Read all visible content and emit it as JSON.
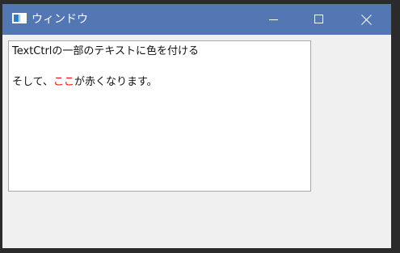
{
  "window": {
    "title": "ウィンドウ",
    "icon": "app-window-icon",
    "controls": {
      "minimize_icon": "minimize-icon",
      "maximize_icon": "maximize-icon",
      "close_icon": "close-icon"
    }
  },
  "textctrl": {
    "line1": "TextCtrlの一部のテキストに色を付ける",
    "line3_before": "そして、",
    "line3_highlight": "ここ",
    "line3_after": "が赤くなります。",
    "highlight_color": "#ff0000"
  },
  "colors": {
    "titlebar": "#5277b3",
    "window_bg": "#f0f0f0"
  }
}
